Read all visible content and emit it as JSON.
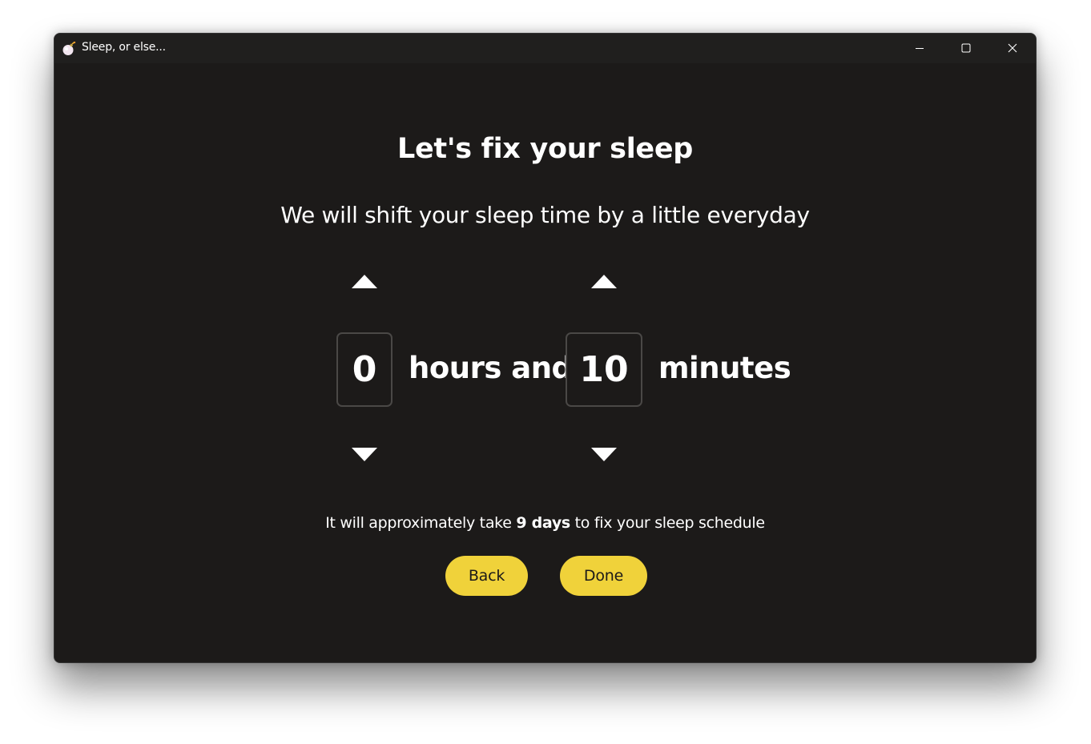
{
  "window": {
    "title": "Sleep, or else...",
    "background": "#1c1a19",
    "accent": "#f0d23a"
  },
  "titlebar": {
    "icons": [
      "app-bomb-icon",
      "minimize-icon",
      "maximize-icon",
      "close-icon"
    ]
  },
  "main": {
    "heading": "Let's fix your sleep",
    "subheading": "We will shift your sleep time by a little everyday",
    "hours_value": "0",
    "hours_label": "hours and",
    "minutes_value": "10",
    "minutes_label": "minutes",
    "estimate_prefix": "It will approximately take ",
    "estimate_days": "9 days",
    "estimate_suffix": " to fix your sleep schedule",
    "back_label": "Back",
    "done_label": "Done"
  }
}
